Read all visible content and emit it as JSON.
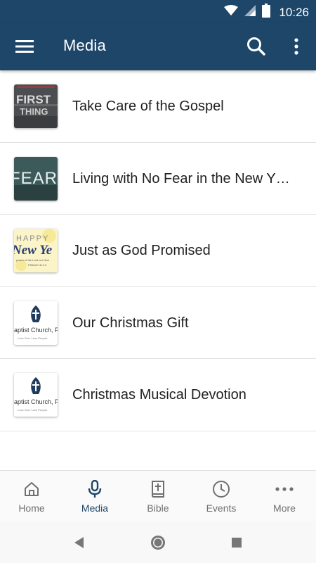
{
  "status_bar": {
    "time": "10:26"
  },
  "app_bar": {
    "title": "Media"
  },
  "media_items": [
    {
      "title": "Take Care of the Gospel",
      "thumb_text": [
        "FIRST",
        "THING"
      ]
    },
    {
      "title": "Living with No Fear in the New Y…",
      "thumb_text": [
        "FEAR"
      ]
    },
    {
      "title": "Just as God Promised",
      "thumb_text": [
        "HAPPY",
        "New Ye",
        "power of the Lord our God",
        "PSALM 18:1-3"
      ]
    },
    {
      "title": "Our Christmas Gift",
      "thumb_text": [
        "aptist Church, P",
        "Love God. Love People."
      ]
    },
    {
      "title": "Christmas Musical Devotion",
      "thumb_text": [
        "aptist Church, P",
        "Love God. Love People."
      ]
    }
  ],
  "bottom_nav": [
    {
      "label": "Home",
      "icon": "home-icon"
    },
    {
      "label": "Media",
      "icon": "microphone-icon",
      "active": true
    },
    {
      "label": "Bible",
      "icon": "bible-icon"
    },
    {
      "label": "Events",
      "icon": "clock-icon"
    },
    {
      "label": "More",
      "icon": "more-horizontal-icon"
    }
  ],
  "colors": {
    "primary": "#1e4669",
    "nav_inactive": "#707070",
    "divider": "#e2e2e2"
  }
}
